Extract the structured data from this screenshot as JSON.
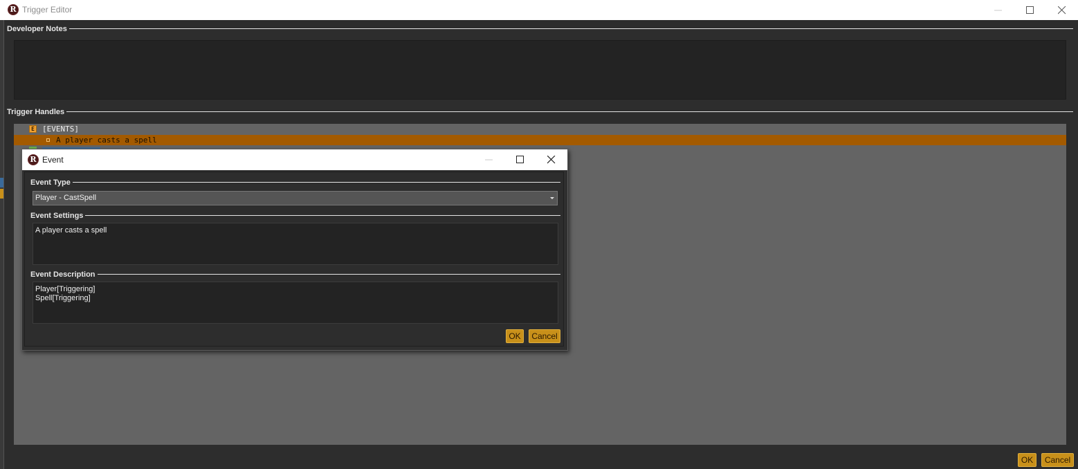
{
  "window": {
    "title": "Trigger Editor",
    "logo_letter": "R"
  },
  "sections": {
    "developer_notes_label": "Developer Notes",
    "trigger_handles_label": "Trigger Handles"
  },
  "tree": {
    "root_icon_letter": "E",
    "root_label": "[EVENTS]",
    "event_item_label": "A player casts a spell"
  },
  "footer": {
    "ok_label": "OK",
    "cancel_label": "Cancel"
  },
  "dialog": {
    "title": "Event",
    "logo_letter": "R",
    "event_type_label": "Event Type",
    "event_type_value": "Player - CastSpell",
    "event_settings_label": "Event Settings",
    "event_settings_text": "A player casts a spell",
    "event_description_label": "Event Description",
    "event_description_lines": [
      "Player[Triggering]",
      "Spell[Triggering]"
    ],
    "ok_label": "OK",
    "cancel_label": "Cancel"
  },
  "colors": {
    "accent_button": "#c8901a",
    "selected_row": "#a35a00",
    "panel_bg": "#2d2d2d",
    "tree_bg": "#646464"
  }
}
